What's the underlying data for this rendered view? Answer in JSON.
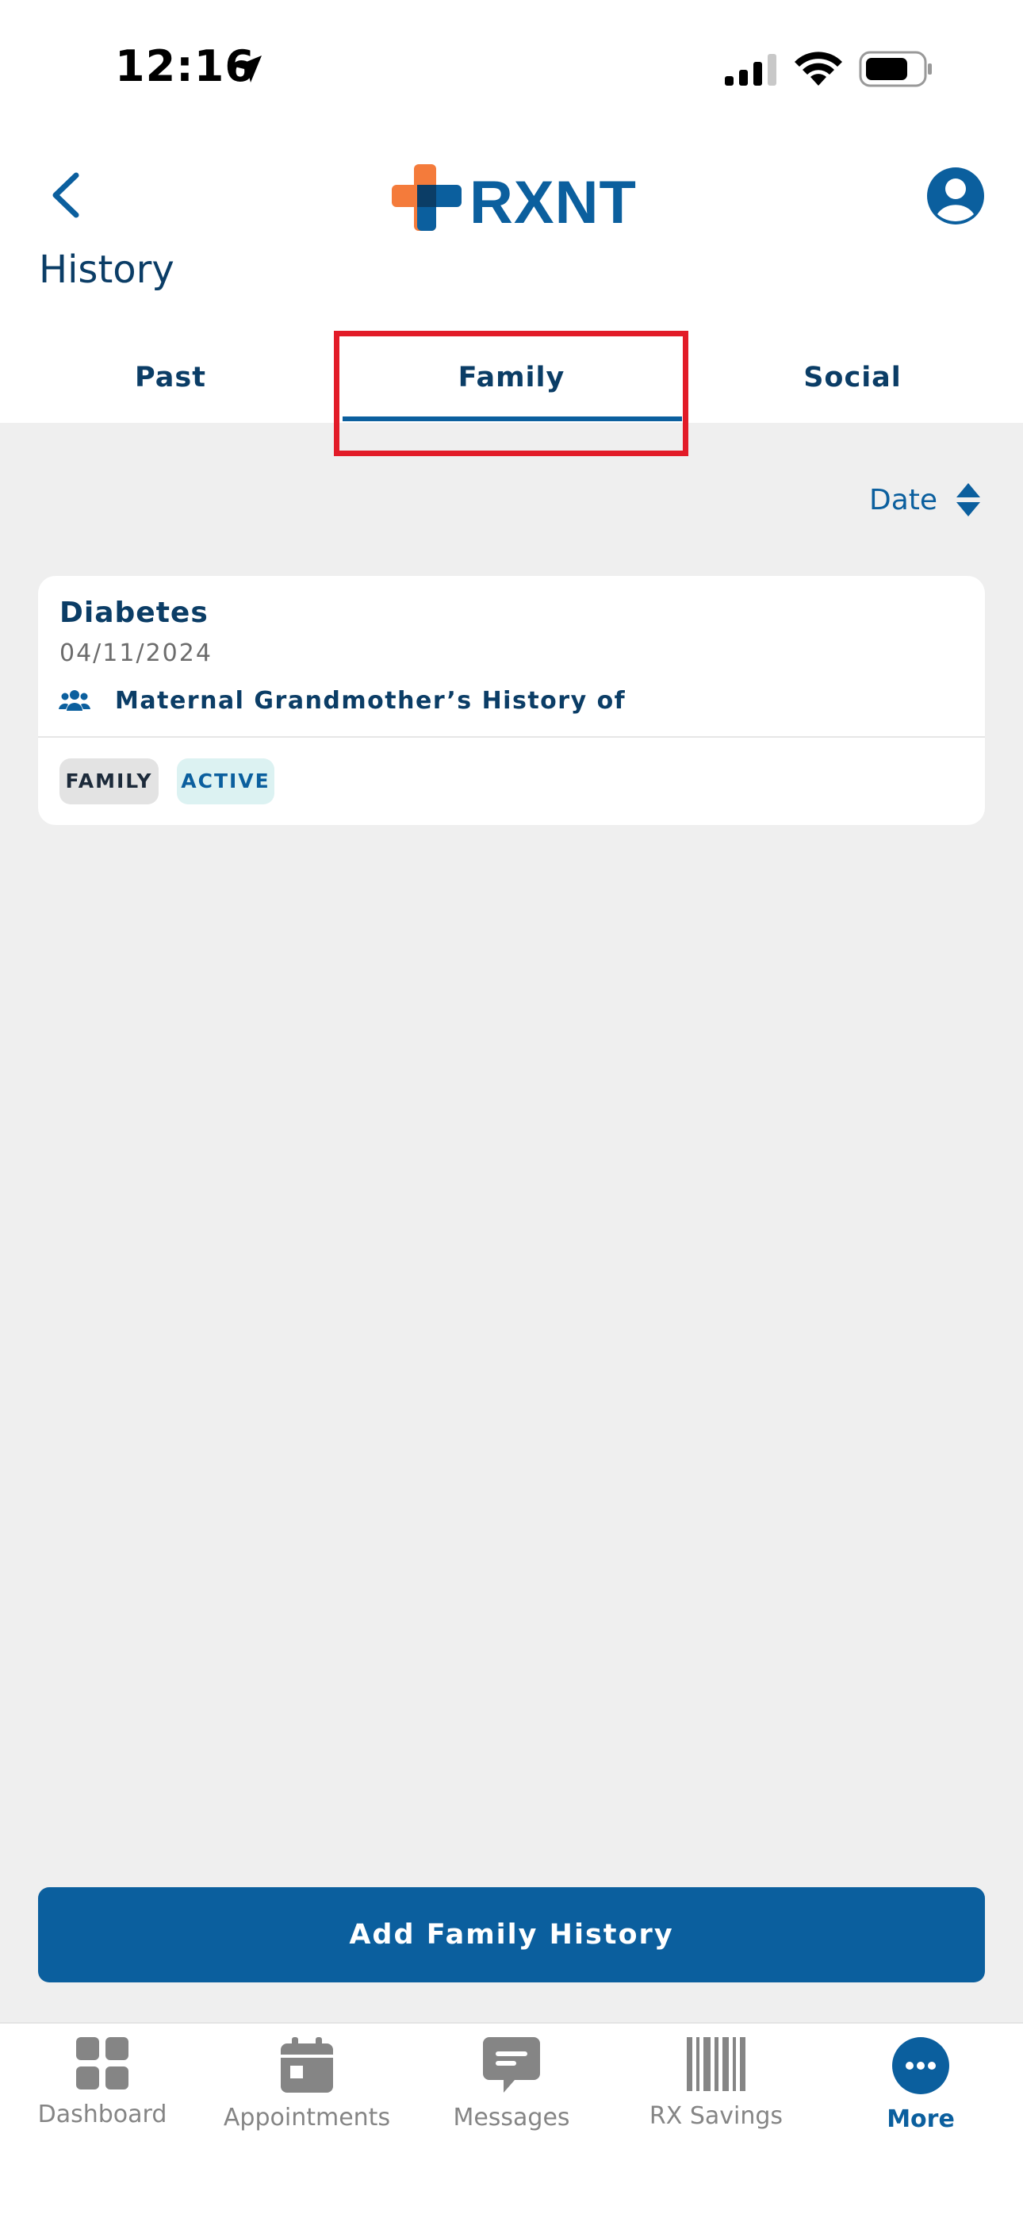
{
  "status_bar": {
    "time": "12:16"
  },
  "header": {
    "logo_text": "RXNT",
    "title": "History"
  },
  "tabs": [
    {
      "label": "Past"
    },
    {
      "label": "Family"
    },
    {
      "label": "Social"
    }
  ],
  "active_tab": "Family",
  "sort": {
    "label": "Date"
  },
  "records": [
    {
      "title": "Diabetes",
      "date": "04/11/2024",
      "description": "Maternal Grandmother’s History of",
      "badges": [
        "FAMILY",
        "ACTIVE"
      ]
    }
  ],
  "add_button": {
    "label": "Add Family History"
  },
  "bottom_nav": [
    {
      "label": "Dashboard",
      "icon": "dashboard-icon"
    },
    {
      "label": "Appointments",
      "icon": "calendar-icon"
    },
    {
      "label": "Messages",
      "icon": "message-icon"
    },
    {
      "label": "RX Savings",
      "icon": "barcode-icon"
    },
    {
      "label": "More",
      "icon": "more-icon"
    }
  ],
  "colors": {
    "brand": "#0b5f9e",
    "highlight": "#e21b28",
    "logo_orange": "#f47b3b"
  }
}
